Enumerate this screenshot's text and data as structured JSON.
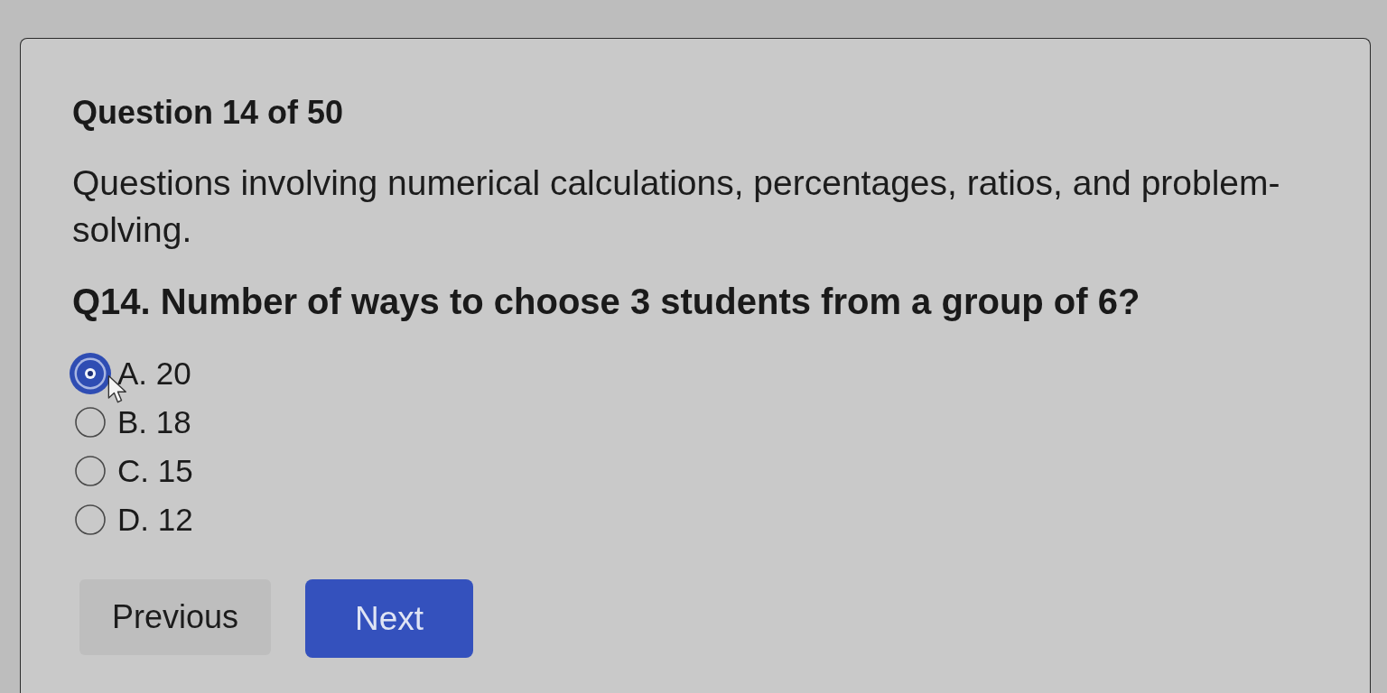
{
  "quiz": {
    "progress": "Question 14 of 50",
    "description": "Questions involving numerical calculations, percentages, ratios, and problem-solving.",
    "question": "Q14. Number of ways to choose 3 students from a group of 6?",
    "options": [
      {
        "label": "A. 20",
        "selected": true
      },
      {
        "label": "B. 18",
        "selected": false
      },
      {
        "label": "C. 15",
        "selected": false
      },
      {
        "label": "D. 12",
        "selected": false
      }
    ],
    "buttons": [
      {
        "label": "Previous",
        "kind": "secondary"
      },
      {
        "label": "Next",
        "kind": "primary"
      }
    ]
  }
}
